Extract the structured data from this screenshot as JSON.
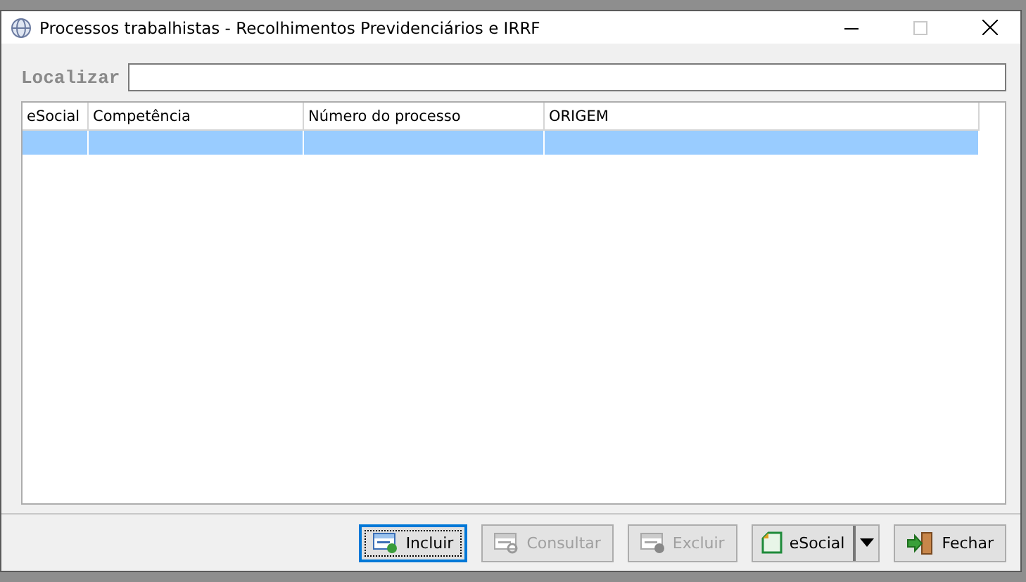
{
  "window": {
    "title": "Processos trabalhistas - Recolhimentos Previdenciários e IRRF"
  },
  "search": {
    "label": "Localizar"
  },
  "table": {
    "columns": [
      "eSocial",
      "Competência",
      "Número do processo",
      "ORIGEM"
    ],
    "rows": [
      {
        "selected": true
      }
    ]
  },
  "buttons": [
    {
      "label": "Incluir",
      "kind": "add",
      "disabled": false,
      "focused": true
    },
    {
      "label": "Consultar",
      "kind": "view",
      "disabled": true,
      "focused": false
    },
    {
      "label": "Excluir",
      "kind": "delete",
      "disabled": true,
      "focused": false
    },
    {
      "label": "eSocial",
      "kind": "split",
      "disabled": false,
      "focused": false
    },
    {
      "label": "Fechar",
      "kind": "exit",
      "disabled": false,
      "focused": false
    }
  ]
}
